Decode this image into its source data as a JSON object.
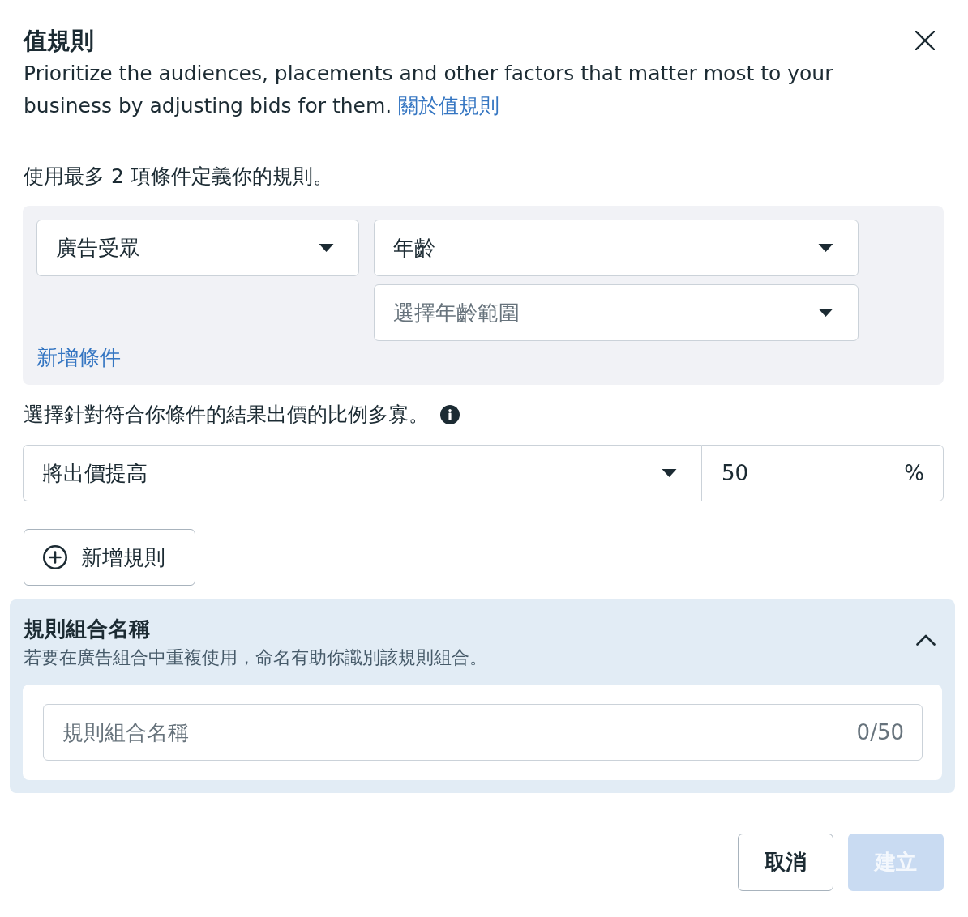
{
  "dialog": {
    "title": "值規則",
    "description": "Prioritize the audiences, placements and other factors that matter most to your business by adjusting bids for them.",
    "help_link": "關於值規則"
  },
  "conditions": {
    "label": "使用最多 2 項條件定義你的規則。",
    "rows": [
      {
        "category": {
          "value": "廣告受眾"
        },
        "attribute": {
          "value": "年齡"
        },
        "range": {
          "placeholder": "選擇年齡範圍"
        }
      }
    ],
    "add_condition_link": "新增條件"
  },
  "bid": {
    "label": "選擇針對符合你條件的結果出價的比例多寡。",
    "action": {
      "value": "將出價提高"
    },
    "amount": {
      "value": "50",
      "unit": "%"
    }
  },
  "add_rule_button": "新增規則",
  "rule_set_name": {
    "title": "規則組合名稱",
    "subtitle": "若要在廣告組合中重複使用，命名有助你識別該規則組合。",
    "expanded": true,
    "input": {
      "placeholder": "規則組合名稱",
      "counter": "0/50"
    }
  },
  "footer": {
    "buttons": [
      {
        "label": "取消",
        "kind": "secondary",
        "disabled": false
      },
      {
        "label": "建立",
        "kind": "primary",
        "disabled": true
      }
    ]
  }
}
